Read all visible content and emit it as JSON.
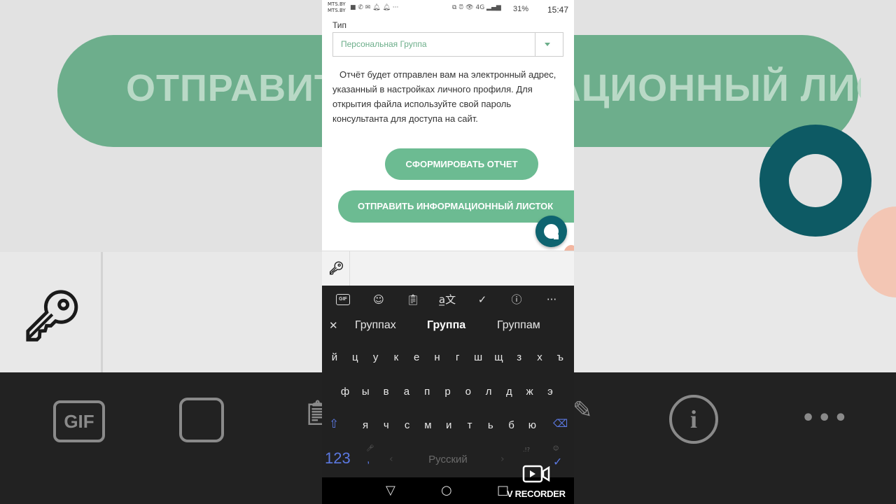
{
  "background": {
    "banner_text": "ОТПРАВИТЬ ИНФОРМАЦИОННЫЙ ЛИСТОК"
  },
  "status_bar": {
    "carrier_line1": "MTS.BY",
    "carrier_line2": "MTS.BY",
    "network": "4G",
    "battery": "31%",
    "time": "15:47"
  },
  "form": {
    "type_label": "Тип",
    "type_value": "Персональная Группа",
    "note": "Отчёт будет отправлен вам на электронный адрес, указанный в настройках личного профиля. Для открытия файла используйте свой пароль консультанта для доступа на сайт.",
    "generate_button": "СФОРМИРОВАТЬ ОТЧЕТ",
    "send_button": "ОТПРАВИТЬ ИНФОРМАЦИОННЫЙ ЛИСТОК"
  },
  "keyboard": {
    "toolbar": {
      "gif": "GIF",
      "icons": [
        "gif-icon",
        "sticker-icon",
        "clipboard-icon",
        "translate-icon",
        "handwriting-icon",
        "info-icon",
        "more-icon"
      ]
    },
    "suggestions": [
      "Группах",
      "Группа",
      "Группам"
    ],
    "row1": [
      "й",
      "ц",
      "у",
      "к",
      "е",
      "н",
      "г",
      "ш",
      "щ",
      "з",
      "х",
      "ъ"
    ],
    "row2": [
      "ф",
      "ы",
      "в",
      "а",
      "п",
      "р",
      "о",
      "л",
      "д",
      "ж",
      "э"
    ],
    "row3": [
      "я",
      "ч",
      "с",
      "м",
      "и",
      "т",
      "ь",
      "б",
      "ю"
    ],
    "numbers_key": "123",
    "comma_key": ",",
    "space_label": "Русский"
  },
  "nav": {
    "recorder_label": "V RECORDER"
  },
  "colors": {
    "accent_green": "#6cbb92",
    "chat_teal": "#0e6470",
    "keyboard_bg": "#212121",
    "keyboard_accent": "#5b78e0"
  }
}
